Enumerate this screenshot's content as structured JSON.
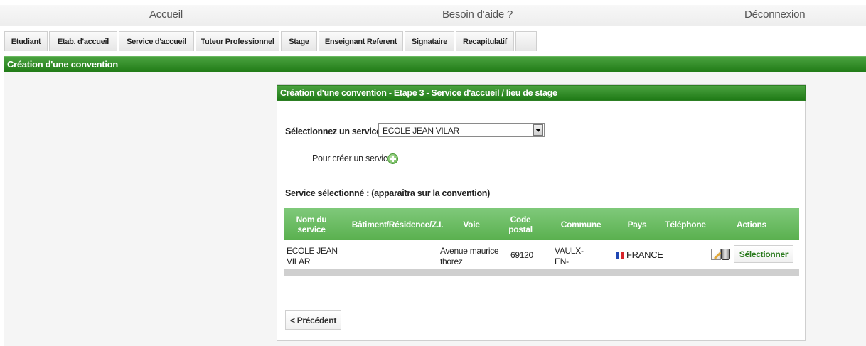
{
  "topnav": {
    "home": "Accueil",
    "help": "Besoin d'aide ?",
    "logout": "Déconnexion"
  },
  "tabs": [
    {
      "label": "Etudiant"
    },
    {
      "label": "Etab. d'accueil"
    },
    {
      "label": "Service d'accueil"
    },
    {
      "label": "Tuteur Professionnel"
    },
    {
      "label": "Stage"
    },
    {
      "label": "Enseignant Referent"
    },
    {
      "label": "Signataire"
    },
    {
      "label": "Recapitulatif"
    },
    {
      "label": ""
    }
  ],
  "main": {
    "title": "Création d'une convention"
  },
  "panel": {
    "title": "Création d'une convention - Etape 3 - Service d'accueil / lieu de stage",
    "select_label": "Sélectionnez un service :",
    "select_value": "ECOLE JEAN VILAR",
    "create_label": "Pour créer un service :",
    "selected_label": "Service sélectionné : (apparaîtra sur la convention)",
    "prev_button": "< Précédent"
  },
  "table": {
    "headers": {
      "name": "Nom du service",
      "building": "Bâtiment/Résidence/Z.I.",
      "street": "Voie",
      "postal": "Code postal",
      "city": "Commune",
      "country": "Pays",
      "phone": "Téléphone",
      "actions": "Actions"
    },
    "rows": [
      {
        "name": "ECOLE JEAN VILAR",
        "building": "",
        "street": "Avenue maurice thorez",
        "postal": "69120",
        "city": "VAULX-EN-VELIN",
        "country": "FRANCE",
        "phone": "",
        "action": "Sélectionner"
      }
    ]
  },
  "colors": {
    "accent_green": "#2a8a21",
    "table_header": "#6abf62"
  },
  "icons": {
    "add": "plus-circle-icon",
    "edit": "edit-icon",
    "delete": "trash-icon",
    "flag": "france-flag-icon"
  }
}
